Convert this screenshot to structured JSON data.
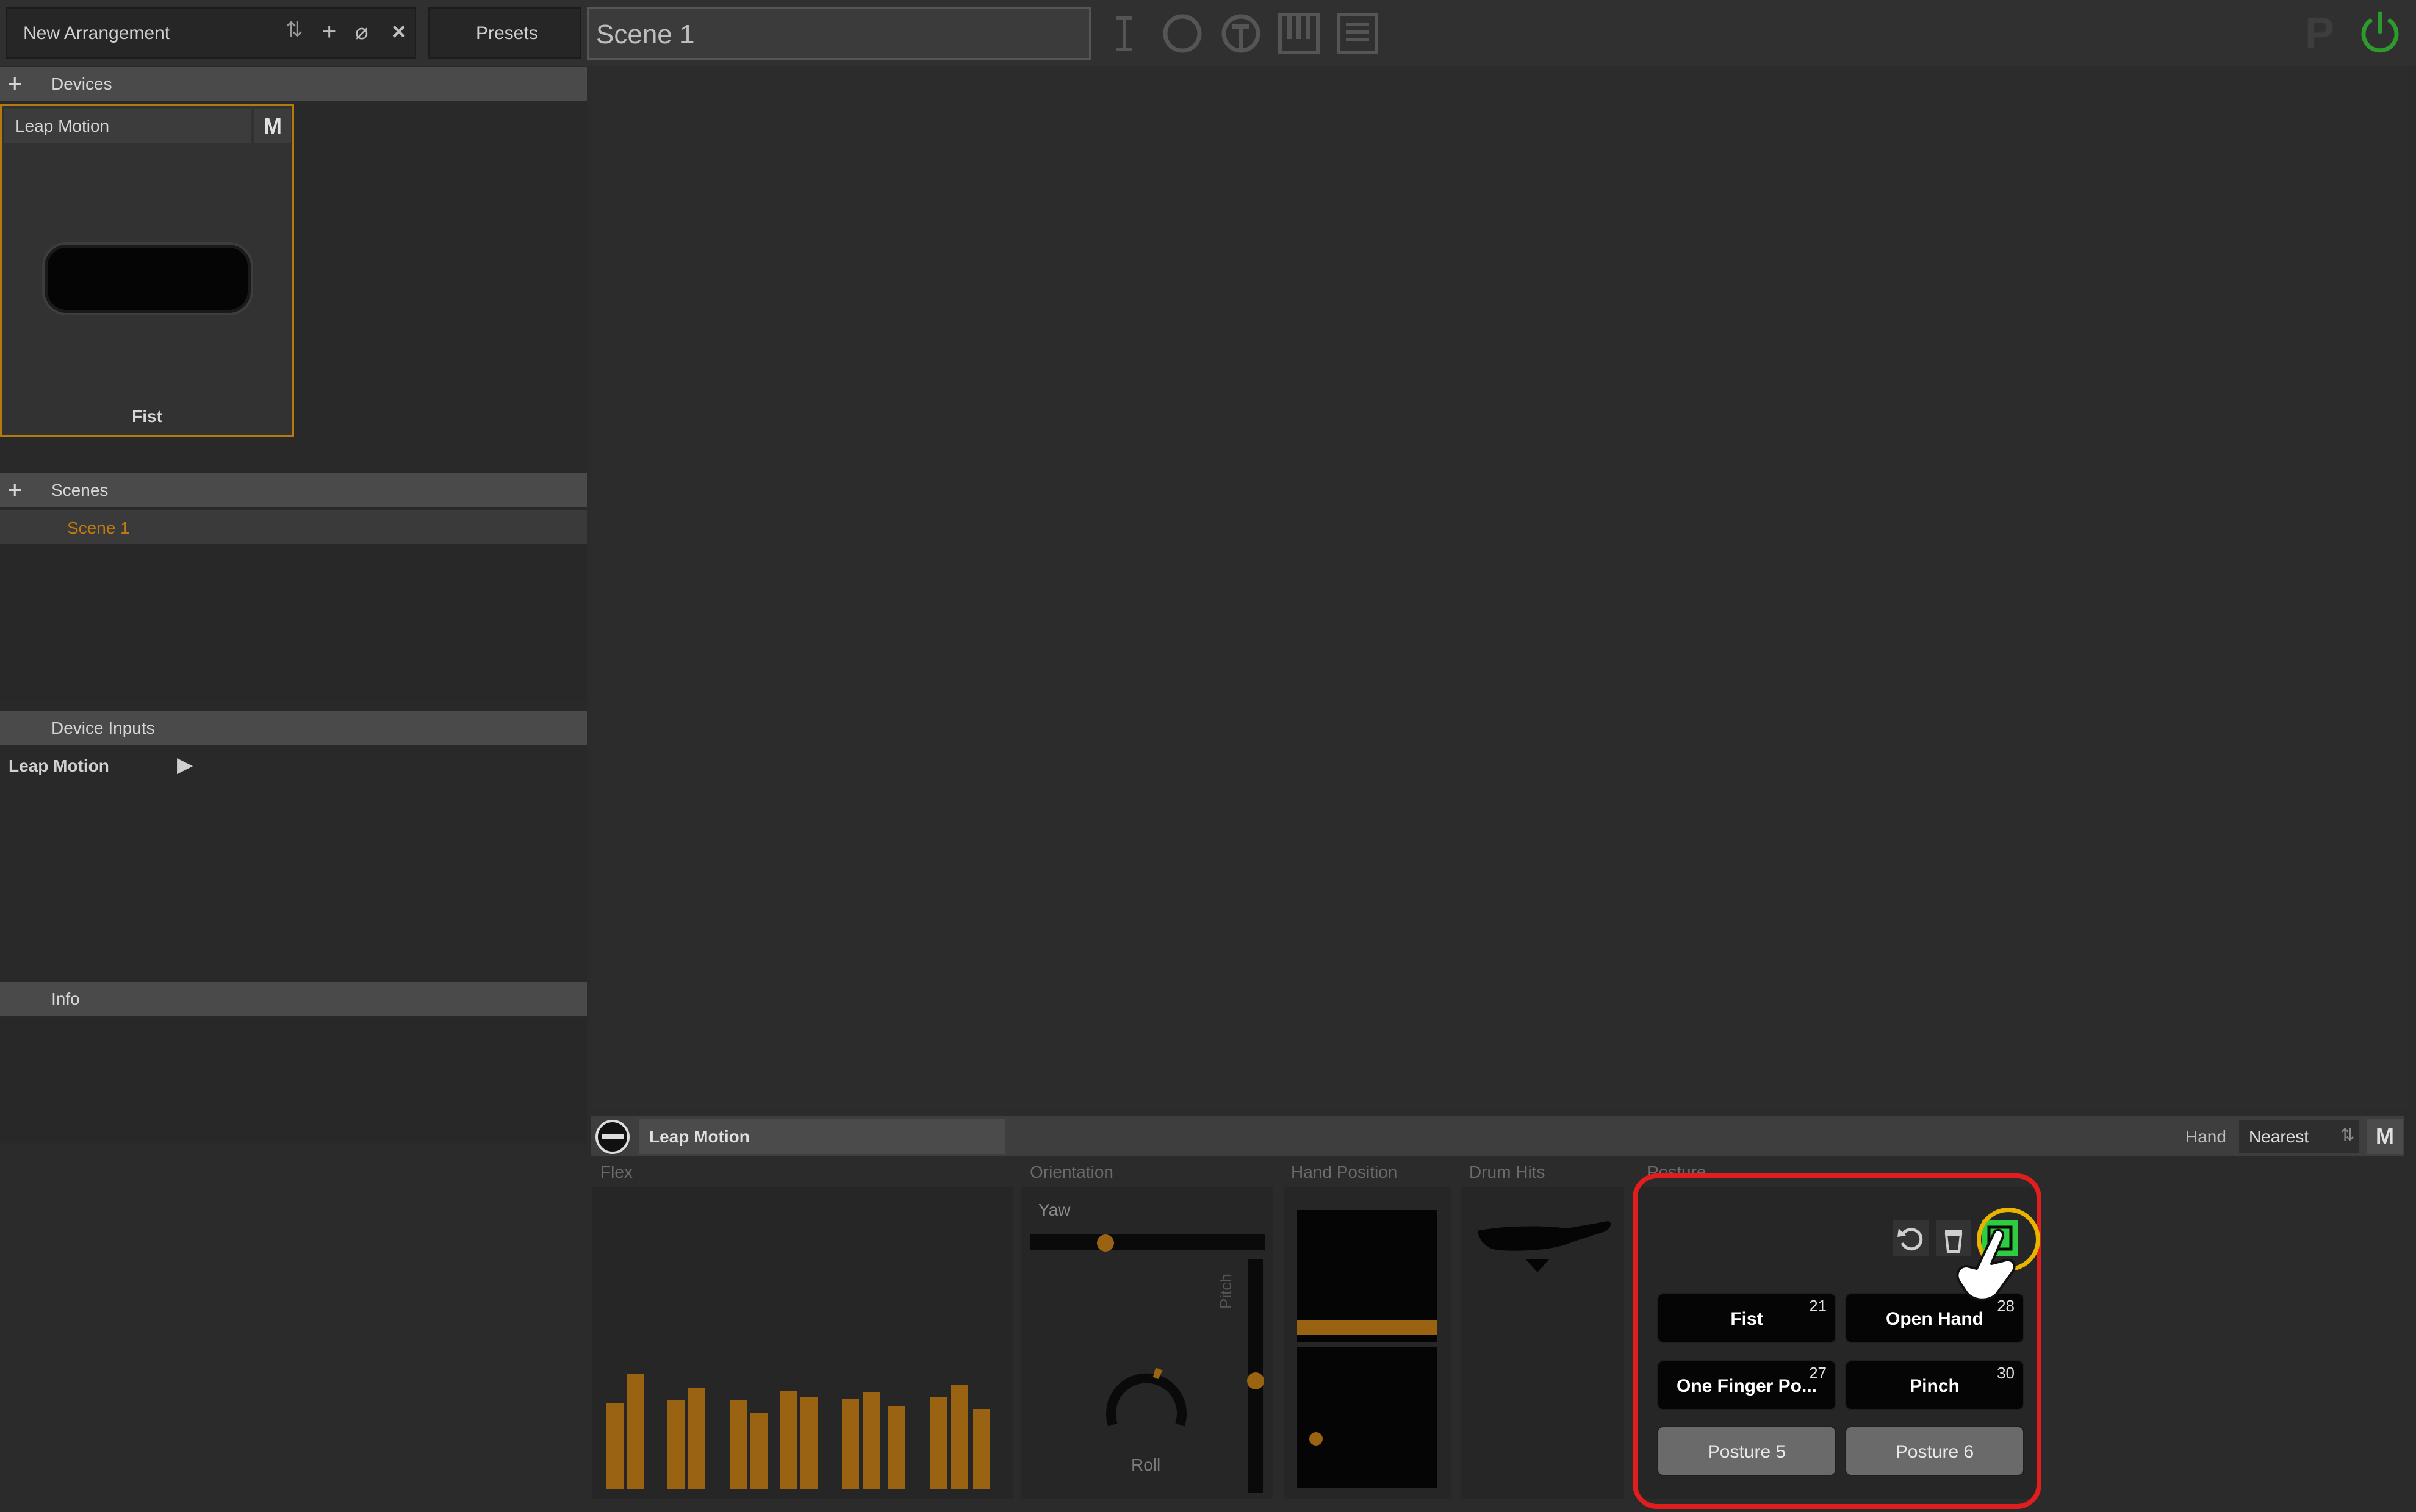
{
  "toolbar": {
    "arrangement_label": "New Arrangement",
    "presets_label": "Presets",
    "scene_title": "Scene 1",
    "power_color": "#2e9a2e"
  },
  "left": {
    "devices_header": "Devices",
    "device_card": {
      "title": "Leap Motion",
      "m_label": "M",
      "gesture_label": "Fist"
    },
    "scenes_header": "Scenes",
    "scenes": [
      "Scene 1"
    ],
    "device_inputs_header": "Device Inputs",
    "device_inputs": [
      "Leap Motion"
    ],
    "info_header": "Info"
  },
  "strip": {
    "device_name": "Leap Motion",
    "hand_label": "Hand",
    "hand_value": "Nearest",
    "m_label": "M"
  },
  "panels": {
    "flex_label": "Flex",
    "orientation_label": "Orientation",
    "yaw_label": "Yaw",
    "pitch_label": "Pitch",
    "roll_label": "Roll",
    "hand_position_label": "Hand Position",
    "drum_hits_label": "Drum Hits",
    "posture_label": "Posture"
  },
  "flex_bars": [
    0.42,
    0.62,
    0.44,
    0.52,
    0.44,
    0.35,
    0.5,
    0.46,
    0.45,
    0.49,
    0.4,
    0.46,
    0.54,
    0.38
  ],
  "postures": [
    {
      "label": "Fist",
      "num": "21",
      "trained": true
    },
    {
      "label": "Open Hand",
      "num": "28",
      "trained": true
    },
    {
      "label": "One Finger Po...",
      "num": "27",
      "trained": true
    },
    {
      "label": "Pinch",
      "num": "30",
      "trained": true
    },
    {
      "label": "Posture 5",
      "num": "",
      "trained": false
    },
    {
      "label": "Posture 6",
      "num": "",
      "trained": false
    }
  ],
  "colors": {
    "accent": "#b87810",
    "highlight_red": "#e21d1d",
    "highlight_yellow": "#e8b400",
    "record_green": "#2ecc40"
  }
}
